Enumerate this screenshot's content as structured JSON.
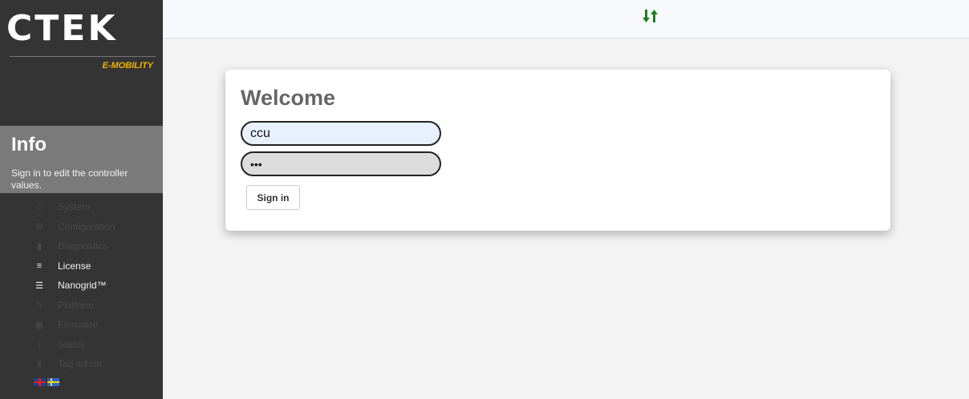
{
  "brand": {
    "logo": "CTEK",
    "tagline": "E-MOBILITY"
  },
  "info": {
    "title": "Info",
    "text": "Sign in to edit the controller values."
  },
  "nav": {
    "items": [
      {
        "label": "System",
        "icon": "home-icon",
        "glyph": "⌂"
      },
      {
        "label": "Configuration",
        "icon": "gear-icon",
        "glyph": "⚙"
      },
      {
        "label": "Diagnostics",
        "icon": "bar-chart-icon",
        "glyph": "▮"
      },
      {
        "label": "License",
        "icon": "license-icon",
        "glyph": "≡"
      },
      {
        "label": "Nanogrid™",
        "icon": "sliders-icon",
        "glyph": "☰"
      },
      {
        "label": "Platform",
        "icon": "wrench-icon",
        "glyph": "✎"
      },
      {
        "label": "Firmware",
        "icon": "chip-icon",
        "glyph": "▦"
      },
      {
        "label": "Status",
        "icon": "info-icon",
        "glyph": "i"
      },
      {
        "label": "Tag admin",
        "icon": "key-icon",
        "glyph": "⚷"
      }
    ]
  },
  "login": {
    "title": "Welcome",
    "username_value": "ccu",
    "password_value": "•••",
    "signin_label": "Sign in"
  },
  "colors": {
    "accent_green": "#1a7f1a",
    "tagline_yellow": "#f0b400"
  }
}
